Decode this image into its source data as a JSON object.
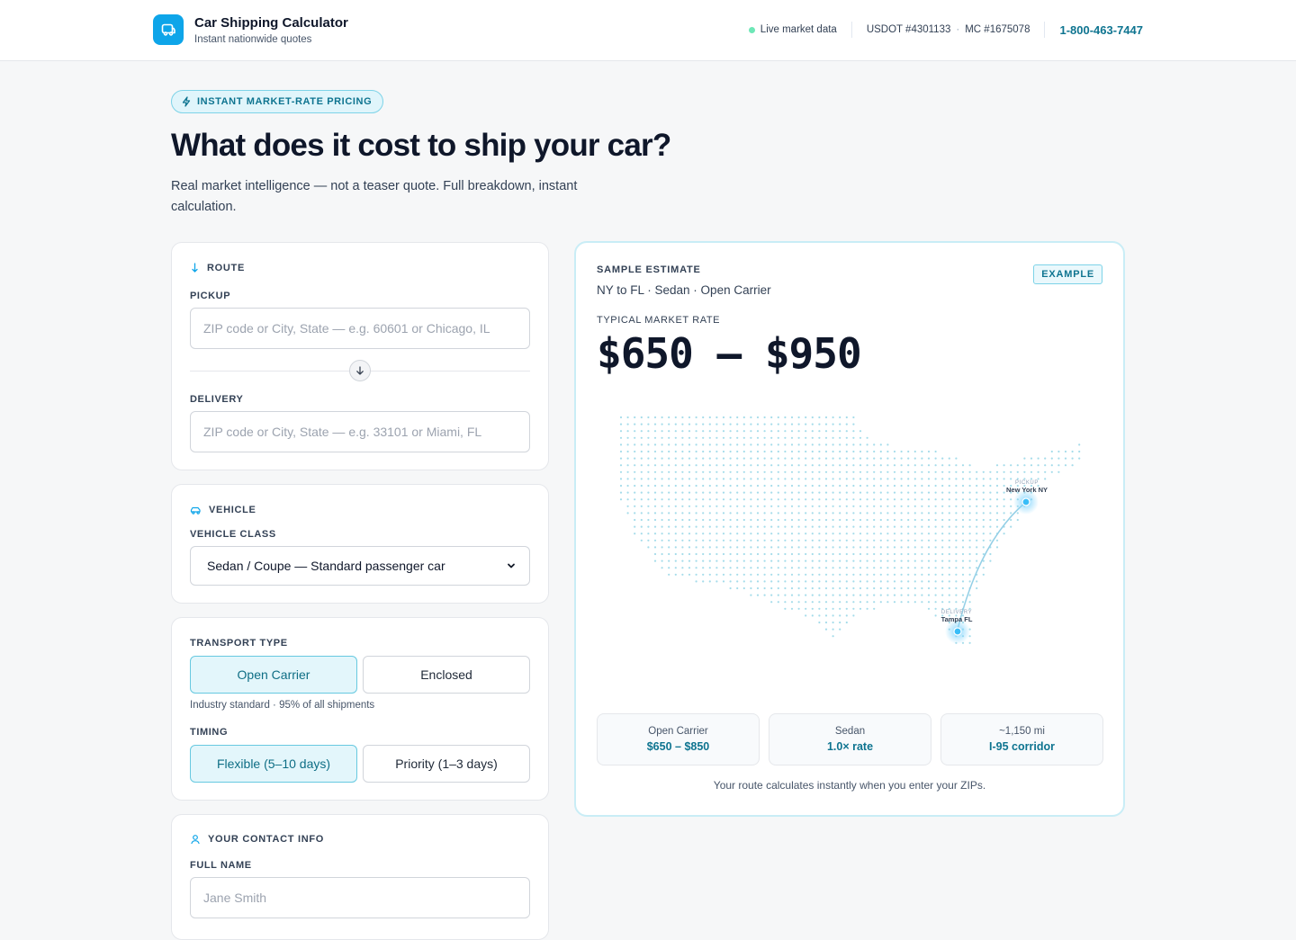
{
  "header": {
    "title": "Car Shipping Calculator",
    "subtitle": "Instant nationwide quotes",
    "live_label": "Live market data",
    "usdot": "USDOT #4301133",
    "dot": "·",
    "mc": "MC #1675078",
    "phone": "1-800-463-7447"
  },
  "hero": {
    "pill": "INSTANT MARKET-RATE PRICING",
    "title": "What does it cost to ship your car?",
    "subtitle": "Real market intelligence — not a teaser quote. Full breakdown, instant calculation."
  },
  "route": {
    "heading": "ROUTE",
    "pickup_label": "PICKUP",
    "pickup_placeholder": "ZIP code or City, State — e.g. 60601 or Chicago, IL",
    "delivery_label": "DELIVERY",
    "delivery_placeholder": "ZIP code or City, State — e.g. 33101 or Miami, FL"
  },
  "vehicle": {
    "heading": "VEHICLE",
    "class_label": "VEHICLE CLASS",
    "class_value": "Sedan / Coupe — Standard passenger car"
  },
  "transport": {
    "label": "TRANSPORT TYPE",
    "options": [
      "Open Carrier",
      "Enclosed"
    ],
    "selected": "Open Carrier",
    "hint": "Industry standard · 95% of all shipments",
    "timing_label": "TIMING",
    "timing_options": [
      "Flexible (5–10 days)",
      "Priority (1–3 days)"
    ],
    "timing_selected": "Flexible (5–10 days)"
  },
  "contact": {
    "heading": "YOUR CONTACT INFO",
    "name_label": "FULL NAME",
    "name_placeholder": "Jane Smith"
  },
  "estimate": {
    "label": "SAMPLE ESTIMATE",
    "route": "NY to FL · Sedan · Open Carrier",
    "badge": "EXAMPLE",
    "rate_label": "TYPICAL MARKET RATE",
    "rate_value": "$650 – $950",
    "map": {
      "pickup_tag": "PICKUP",
      "pickup_city": "New York NY",
      "delivery_tag": "DELIVERY",
      "delivery_city": "Tampa FL"
    },
    "stats": [
      {
        "top": "Open Carrier",
        "bottom": "$650 – $850"
      },
      {
        "top": "Sedan",
        "bottom": "1.0× rate"
      },
      {
        "top": "~1,150 mi",
        "bottom": "I-95 corridor"
      }
    ],
    "footnote": "Your route calculates instantly when you enter your ZIPs."
  },
  "colors": {
    "accent": "#0ea5e9",
    "accent_dark": "#0e7490",
    "map_dot": "#a5dcea",
    "live": "#6ee7b7"
  },
  "icons": {
    "brand": "truck-icon",
    "pill": "bolt-icon",
    "route": "route-icon",
    "swap": "arrow-down-icon",
    "vehicle": "car-icon",
    "select": "chevron-down-icon",
    "contact": "user-icon"
  }
}
